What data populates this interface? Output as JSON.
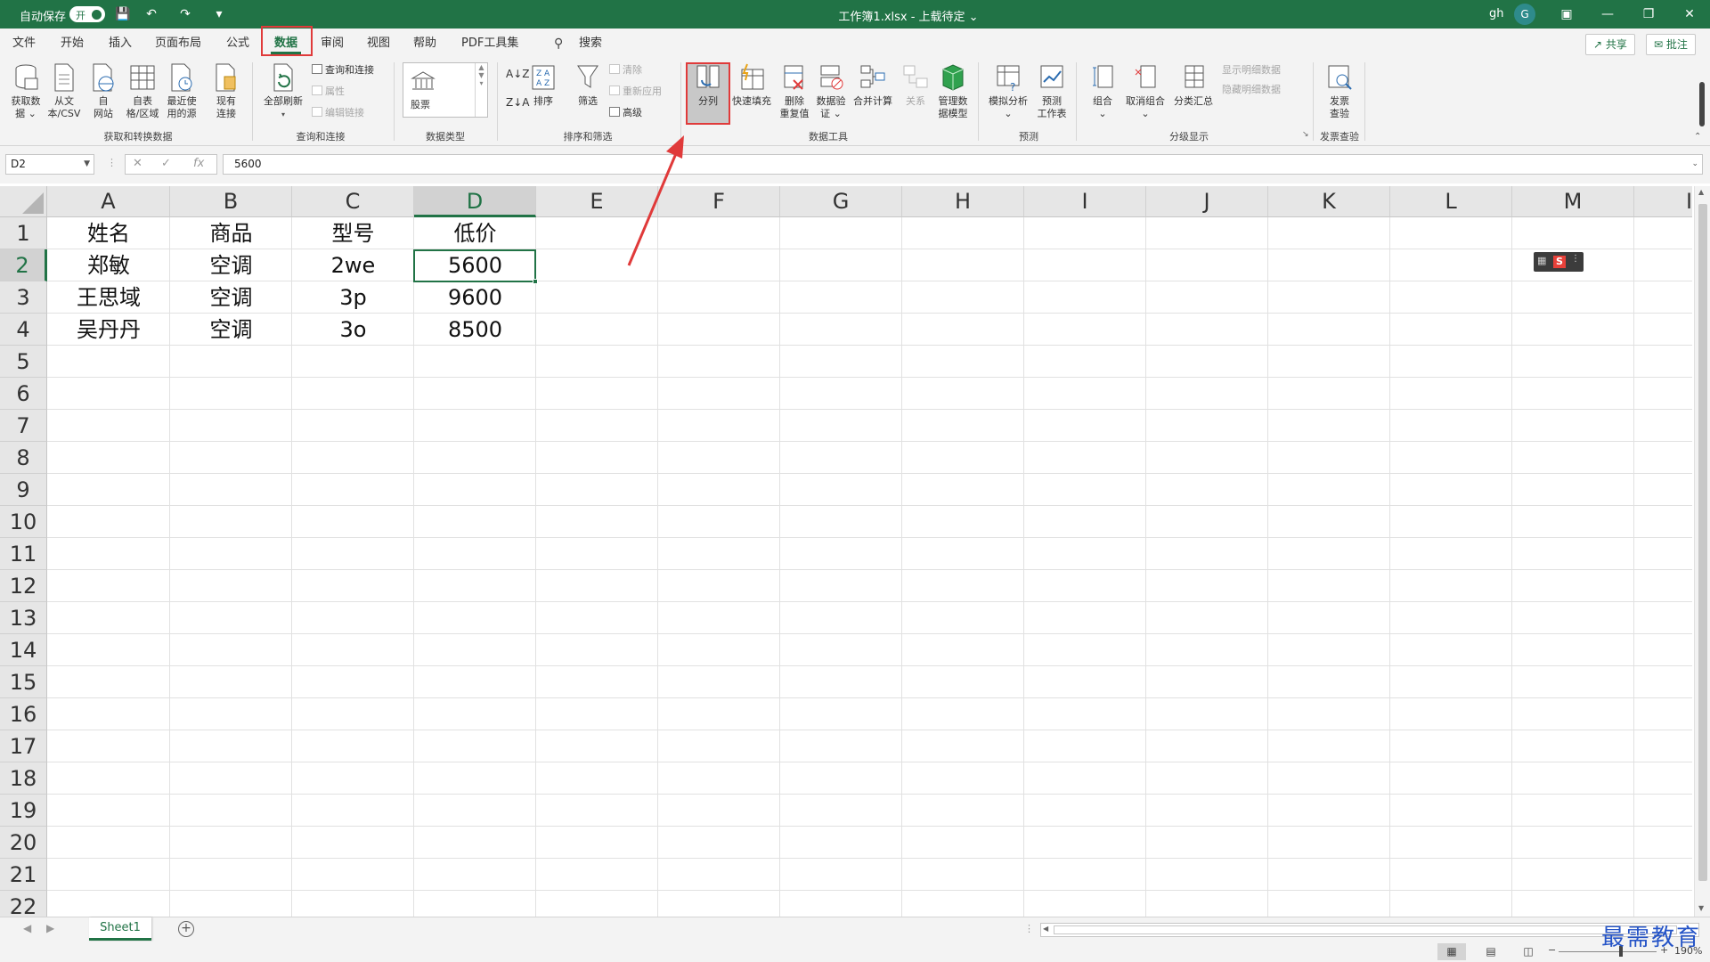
{
  "titlebar": {
    "autosave_label": "自动保存",
    "autosave_state": "开",
    "doc_title": "工作簿1.xlsx - 上载待定 ⌄",
    "user_name": "gh",
    "avatar_letter": "G"
  },
  "menu": {
    "tabs": [
      "文件",
      "开始",
      "插入",
      "页面布局",
      "公式",
      "数据",
      "审阅",
      "视图",
      "帮助",
      "PDF工具集"
    ],
    "active_tab": "数据",
    "search_label": "搜索",
    "share_label": "共享",
    "comment_label": "批注"
  },
  "ribbon": {
    "get_data": "获取数\n据 ⌄",
    "from_text": "从文\n本/CSV",
    "from_web": "自\n网站",
    "from_table": "自表\n格/区域",
    "recent_sources": "最近使\n用的源",
    "existing_conn": "现有\n连接",
    "group_get_transform": "获取和转换数据",
    "refresh_all": "全部刷新",
    "queries_conn": "查询和连接",
    "properties": "属性",
    "edit_links": "编辑链接",
    "group_queries": "查询和连接",
    "stock_label": "股票",
    "group_datatype": "数据类型",
    "sort": "排序",
    "filter": "筛选",
    "clear": "清除",
    "reapply": "重新应用",
    "advanced": "高级",
    "group_sort_filter": "排序和筛选",
    "text_to_columns": "分列",
    "flash_fill": "快速填充",
    "remove_dup": "删除\n重复值",
    "data_validation": "数据验\n证 ⌄",
    "consolidate": "合并计算",
    "relationships": "关系",
    "manage_model": "管理数\n据模型",
    "group_data_tools": "数据工具",
    "what_if": "模拟分析\n⌄",
    "forecast_sheet": "预测\n工作表",
    "group_forecast": "预测",
    "group_btn": "组合\n⌄",
    "ungroup": "取消组合\n⌄",
    "subtotal": "分类汇总",
    "show_detail": "显示明细数据",
    "hide_detail": "隐藏明细数据",
    "group_outline": "分级显示",
    "invoice_check": "发票\n查验",
    "group_invoice": "发票查验"
  },
  "formula_bar": {
    "name_box": "D2",
    "fx_label": "fx",
    "value": "5600"
  },
  "sheet": {
    "columns": [
      "A",
      "B",
      "C",
      "D",
      "E",
      "F",
      "G",
      "H",
      "I",
      "J",
      "K",
      "L",
      "M",
      "I"
    ],
    "row_numbers": [
      "1",
      "2",
      "3",
      "4",
      "5",
      "6",
      "7",
      "8",
      "9",
      "10",
      "11",
      "12",
      "13",
      "14",
      "15",
      "16",
      "17",
      "18",
      "19",
      "20",
      "21",
      "22"
    ],
    "cells": [
      [
        "姓名",
        "商品",
        "型号",
        "低价"
      ],
      [
        "郑敏",
        "空调",
        "2we",
        "5600"
      ],
      [
        "王思域",
        "空调",
        "3p",
        "9600"
      ],
      [
        "吴丹丹",
        "空调",
        "3o",
        "8500"
      ]
    ],
    "active_cell": "D2"
  },
  "sheet_tabs": {
    "tabs": [
      "Sheet1"
    ],
    "add_label": "+"
  },
  "statusbar": {
    "zoom": "190%"
  },
  "watermark": "最需教育",
  "colors": {
    "accent": "#217346",
    "highlight": "#e03a3a"
  }
}
